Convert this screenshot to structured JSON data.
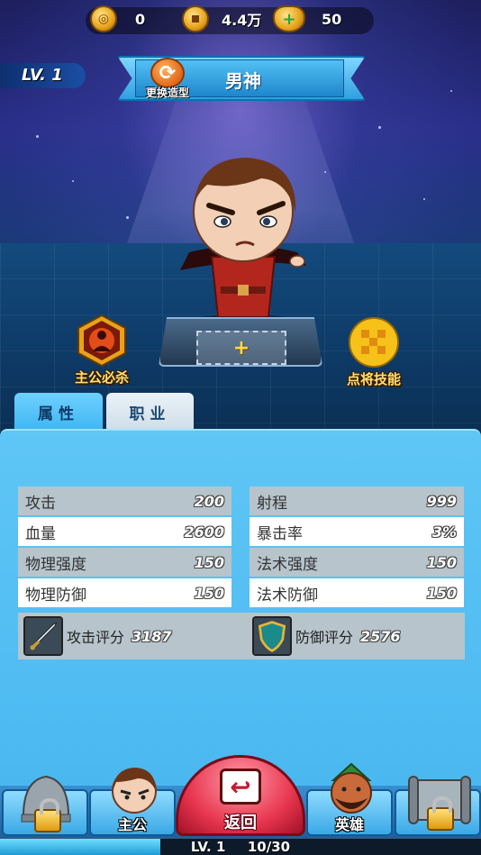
{
  "resources": {
    "gold_icon": "gold-ingot-icon",
    "gold_value": "0",
    "copper_icon": "copper-coin-icon",
    "copper_value": "4.4万",
    "yuanbao_icon": "yuanbao-add-icon",
    "yuanbao_value": "50"
  },
  "level_badge": "LV. 1",
  "hero": {
    "name": "男神",
    "change_look_label": "更换造型"
  },
  "skills": {
    "lord_ultimate": "主公必杀",
    "general_skill": "点将技能"
  },
  "tabs": {
    "attributes": "属性",
    "profession": "职业"
  },
  "stats": [
    {
      "label": "攻击",
      "value": "200"
    },
    {
      "label": "射程",
      "value": "999"
    },
    {
      "label": "血量",
      "value": "2600"
    },
    {
      "label": "暴击率",
      "value": "3%"
    },
    {
      "label": "物理强度",
      "value": "150"
    },
    {
      "label": "法术强度",
      "value": "150"
    },
    {
      "label": "物理防御",
      "value": "150"
    },
    {
      "label": "法术防御",
      "value": "150"
    }
  ],
  "scores": {
    "attack_label": "攻击评分",
    "attack_value": "3187",
    "defense_label": "防御评分",
    "defense_value": "2576"
  },
  "bottom_nav": {
    "lord": "主公",
    "return": "返回",
    "heroes": "英雄"
  },
  "exp_bar": {
    "level": "LV. 1",
    "progress": "10/30",
    "fraction": 0.3333
  },
  "colors": {
    "panel_blue": "#4ab8f0",
    "stat_gray": "#b7c4cc",
    "return_red": "#e8364f",
    "skill_text": "#ffe070"
  }
}
